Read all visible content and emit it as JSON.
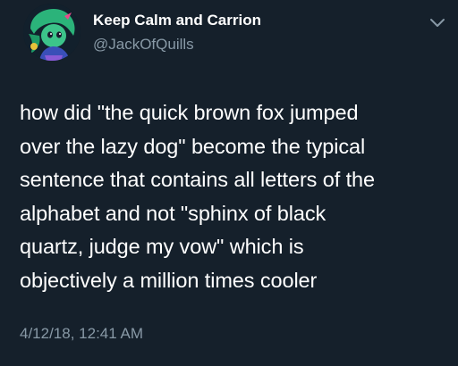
{
  "tweet": {
    "author": {
      "display_name": "Keep Calm and Carrion",
      "handle": "@JackOfQuills",
      "avatar_icon": "avatar-icon"
    },
    "menu_icon": "chevron-down-icon",
    "text_lines": [
      "how did \"the quick brown fox jumped",
      "over the lazy dog\" become the typical",
      "sentence that contains all letters of the",
      "alphabet and not \"sphinx of black",
      "quartz, judge my vow\" which is",
      "objectively a million times cooler"
    ],
    "timestamp": "4/12/18, 12:41 AM"
  },
  "colors": {
    "background": "#15202b",
    "primary_text": "#ffffff",
    "secondary_text": "#8899a6"
  }
}
